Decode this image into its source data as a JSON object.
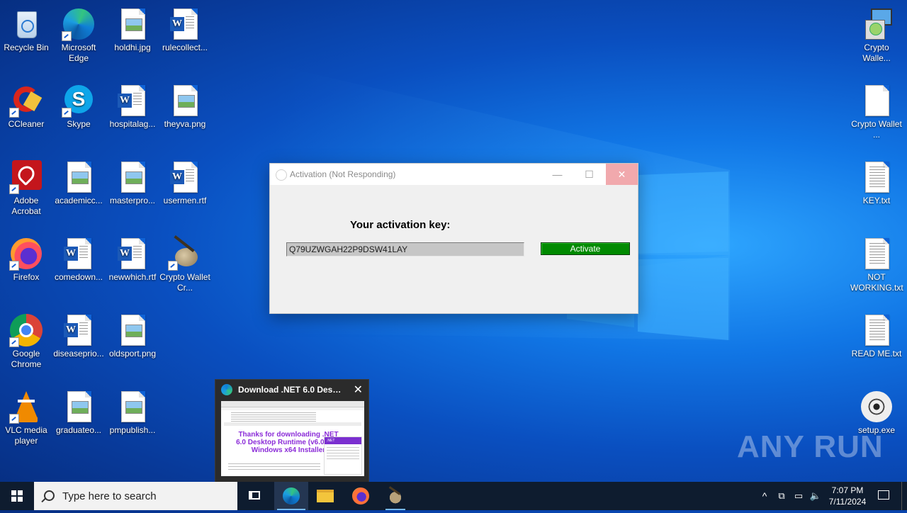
{
  "desktop": {
    "icons": {
      "recycle_bin": "Recycle Bin",
      "edge": "Microsoft Edge",
      "holdhi": "holdhi.jpg",
      "rulecollect": "rulecollect...",
      "ccleaner": "CCleaner",
      "skype": "Skype",
      "hospitalag": "hospitalag...",
      "theyva": "theyva.png",
      "acrobat": "Adobe Acrobat",
      "academicc": "academicc...",
      "masterpro": "masterpro...",
      "usermen": "usermen.rtf",
      "firefox": "Firefox",
      "comedown": "comedown...",
      "newwhich": "newwhich.rtf",
      "crypto_wallet_cr": "Crypto Wallet Cr...",
      "chrome": "Google Chrome",
      "diseasepri": "diseaseprio...",
      "oldsport": "oldsport.png",
      "vlc": "VLC media player",
      "graduateo": "graduateo...",
      "pmpublish": "pmpublish...",
      "crypto_walle_1": "Crypto Walle...",
      "crypto_wallet_2": "Crypto Wallet ...",
      "key_txt": "KEY.txt",
      "not_working": "NOT WORKING.txt",
      "read_me": "READ ME.txt",
      "setup": "setup.exe"
    },
    "watermark": "ANY RUN"
  },
  "activation_window": {
    "title": "Activation (Not Responding)",
    "minimize": "—",
    "maximize": "☐",
    "close": "✕",
    "key_label": "Your activation key:",
    "key_value": "Q79UZWGAH22P9DSW41LAY",
    "activate_button": "Activate"
  },
  "edge_preview": {
    "title": "Download .NET 6.0 Deskt...",
    "close": "✕",
    "thumb_heading": "Thanks for downloading .NET 6.0 Desktop Runtime (v6.0.32) - Windows x64 Installer",
    "thumb_side_header": ".NET"
  },
  "taskbar": {
    "search_placeholder": "Type here to search",
    "tray_chevron": "^",
    "clock_time": "7:07 PM",
    "clock_date": "7/11/2024"
  },
  "colors": {
    "activate_green": "#018a01",
    "close_button_pink": "#f1a9ad",
    "taskbar_bg": "#0e1c2f"
  }
}
